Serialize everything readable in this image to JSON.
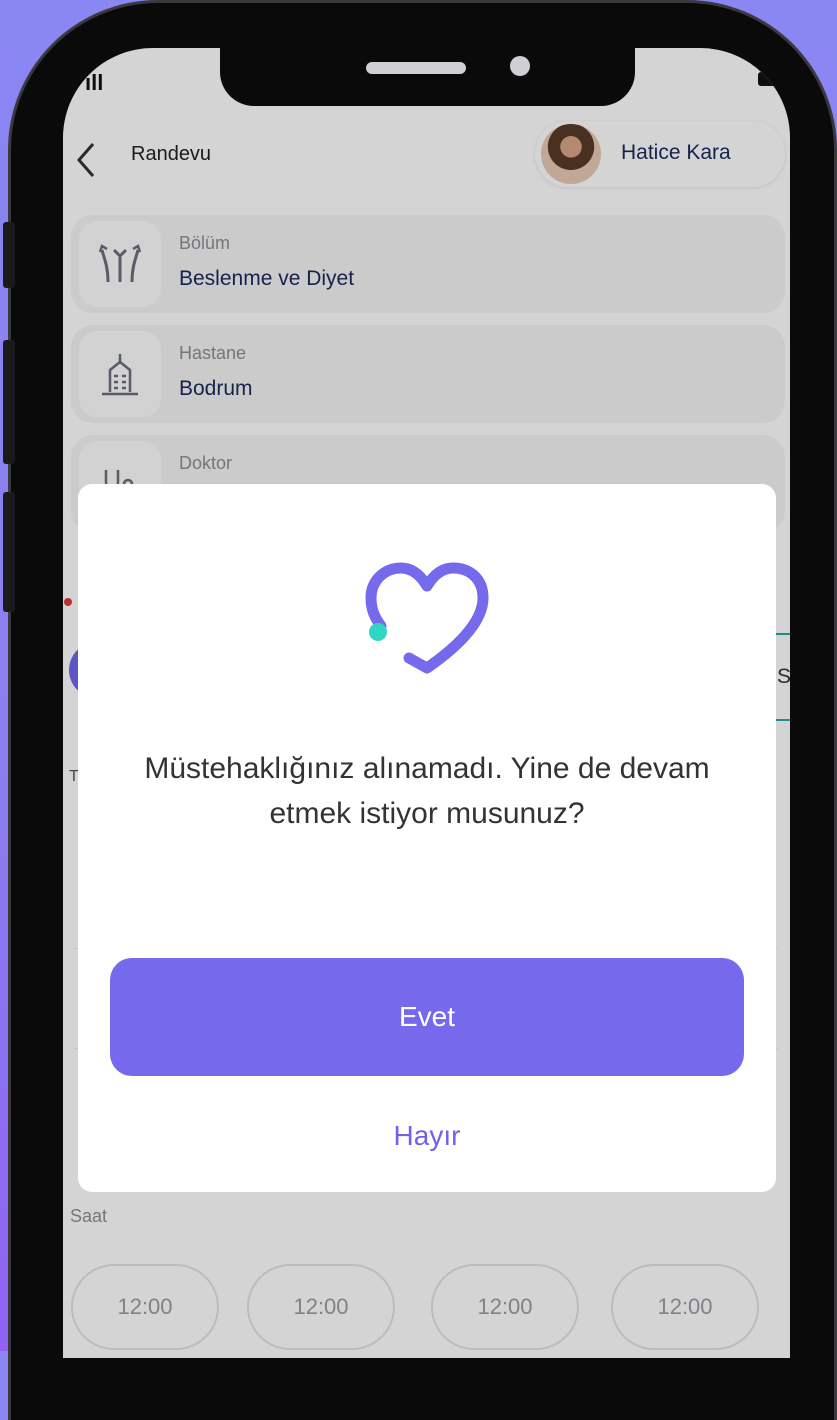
{
  "header": {
    "title": "Randevu",
    "user_name": "Hatice Kara"
  },
  "fields": [
    {
      "label": "Bölüm",
      "value": "Beslenme ve Diyet",
      "icon": "directions-icon"
    },
    {
      "label": "Hastane",
      "value": "Bodrum",
      "icon": "hospital-building-icon"
    },
    {
      "label": "Doktor",
      "value": "",
      "icon": "stethoscope-icon"
    }
  ],
  "background": {
    "tab_fragment": "S",
    "t_fragment": "T",
    "time_section_label": "Saat",
    "time_slots": [
      "12:00",
      "12:00",
      "12:00",
      "12:00"
    ]
  },
  "dialog": {
    "message": "Müstehaklığınız alınamadı. Yine de devam etmek istiyor musunuz?",
    "confirm_label": "Evet",
    "cancel_label": "Hayır",
    "icon": "heart-icon"
  },
  "colors": {
    "accent": "#7569ec",
    "heart_dot": "#2fd6c4",
    "text_dark": "#1b2a5c"
  }
}
